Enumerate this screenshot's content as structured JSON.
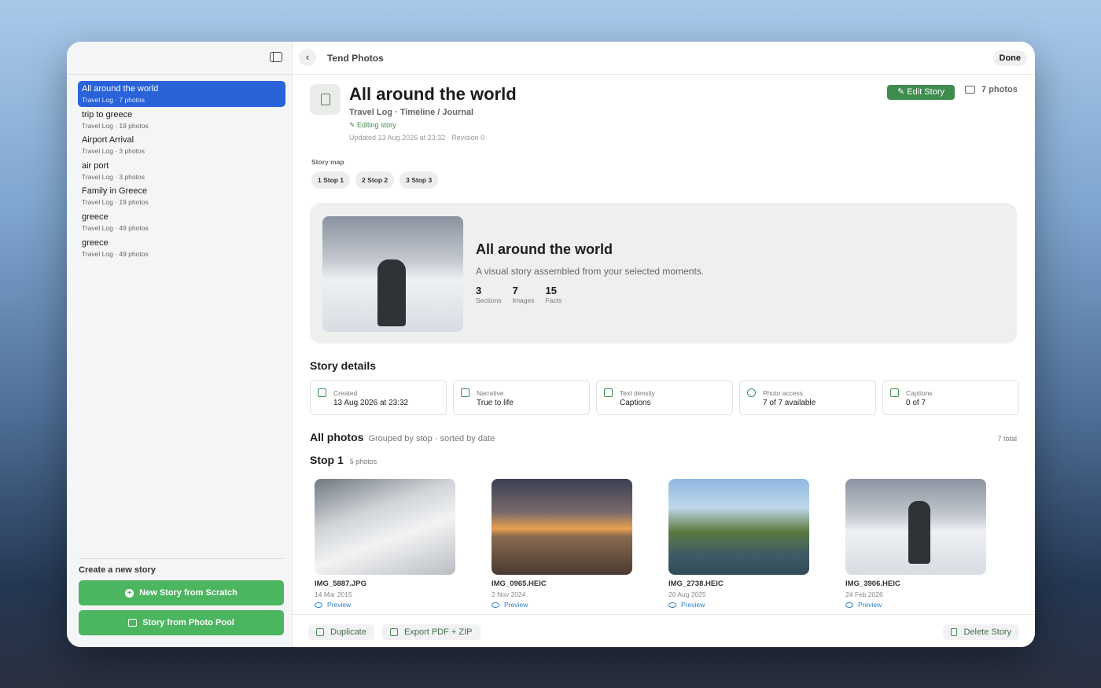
{
  "topbar": {
    "title": "Tend Photos",
    "done_label": "Done",
    "back_icon": "chevron-left-icon"
  },
  "sidebar": {
    "toggle_icon": "sidebar-toggle-icon",
    "stories": [
      {
        "title": "All around the world",
        "sub": "Travel Log · 7 photos",
        "active": true
      },
      {
        "title": "trip to greece",
        "sub": "Travel Log · 19 photos"
      },
      {
        "title": "Airport Arrival",
        "sub": "Travel Log · 3 photos"
      },
      {
        "title": "air port",
        "sub": "Travel Log · 3 photos"
      },
      {
        "title": "Family in Greece",
        "sub": "Travel Log · 19 photos"
      },
      {
        "title": "greece",
        "sub": "Travel Log · 49 photos"
      },
      {
        "title": "greece",
        "sub": "Travel Log · 49 photos"
      }
    ],
    "create_title": "Create a new story",
    "new_scratch_label": "New Story from Scratch",
    "photo_pool_label": "Story from Photo Pool"
  },
  "header": {
    "title": "All around the world",
    "subtitle": "Travel Log · Timeline / Journal",
    "editing": "Editing story",
    "updated": "Updated 13 Aug 2026 at 23:32 · Revision 0",
    "edit_label": "Edit Story",
    "photos_label": "7 photos"
  },
  "story_map": {
    "label": "Story map",
    "stops": [
      "1  Stop 1",
      "2  Stop 2",
      "3  Stop 3"
    ]
  },
  "hero": {
    "title": "All around the world",
    "desc": "A visual story assembled from your selected moments.",
    "stats": [
      {
        "num": "3",
        "label": "Sections"
      },
      {
        "num": "7",
        "label": "Images"
      },
      {
        "num": "15",
        "label": "Facts"
      }
    ]
  },
  "details": {
    "title": "Story details",
    "cards": [
      {
        "label": "Created",
        "value": "13 Aug 2026 at 23:32",
        "icon": "calendar-icon"
      },
      {
        "label": "Narrative",
        "value": "True to life",
        "icon": "narrative-icon"
      },
      {
        "label": "Text density",
        "value": "Captions",
        "icon": "text-lines-icon"
      },
      {
        "label": "Photo access",
        "value": "7 of 7 available",
        "icon": "check-circle-icon"
      },
      {
        "label": "Captions",
        "value": "0 of 7",
        "icon": "speech-bubble-icon"
      }
    ]
  },
  "all_photos": {
    "title": "All photos",
    "sub": "Grouped by stop · sorted by date",
    "total": "7 total",
    "stop_title": "Stop 1",
    "stop_count": "5 photos",
    "photos": [
      {
        "name": "IMG_5887.JPG",
        "date": "14 Mar 2015",
        "preview": "Preview"
      },
      {
        "name": "IMG_0965.HEIC",
        "date": "2 Nov 2024",
        "preview": "Preview"
      },
      {
        "name": "IMG_2738.HEIC",
        "date": "20 Aug 2025",
        "preview": "Preview"
      },
      {
        "name": "IMG_3906.HEIC",
        "date": "24 Feb 2026",
        "preview": "Preview"
      }
    ]
  },
  "bottombar": {
    "duplicate": "Duplicate",
    "export": "Export PDF + ZIP",
    "delete": "Delete Story"
  },
  "colors": {
    "accent_blue": "#2962d9",
    "green": "#4cb55f",
    "dark_green": "#3f8c4e"
  }
}
